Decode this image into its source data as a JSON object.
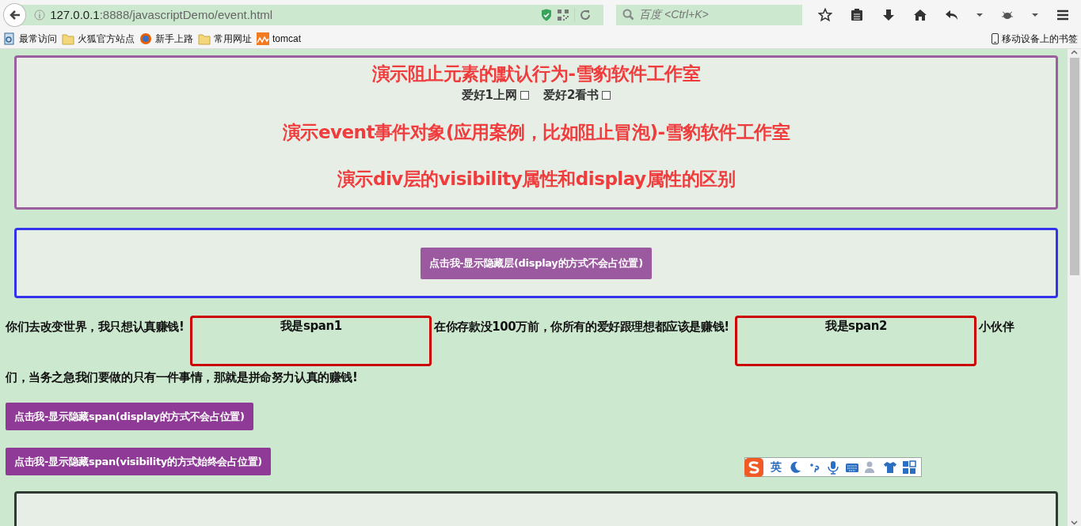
{
  "browser": {
    "url_host": "127.0.0.1",
    "url_rest": ":8888/javascriptDemo/event.html",
    "search": {
      "placeholder": "百度 <Ctrl+K>"
    },
    "bookmarks": [
      {
        "label": "最常访问",
        "kind": "page"
      },
      {
        "label": "火狐官方站点",
        "kind": "folder"
      },
      {
        "label": "新手上路",
        "kind": "globe"
      },
      {
        "label": "常用网址",
        "kind": "folder"
      },
      {
        "label": "tomcat",
        "kind": "tomcat"
      }
    ],
    "mobile_bookmarks": "移动设备上的书签"
  },
  "page": {
    "heading_1": "演示阻止元素的默认行为-雪豹软件工作室",
    "hobbies": [
      {
        "label": "爱好1上网",
        "checked": false
      },
      {
        "label": "爱好2看书",
        "checked": false
      }
    ],
    "heading_2": "演示event事件对象(应用案例，比如阻止冒泡)-雪豹软件工作室",
    "heading_3": "演示div层的visibility属性和display属性的区别",
    "layer_button": "点击我-显示隐藏层(display的方式不会占位置)",
    "paragraph": [
      {
        "kind": "text",
        "text": "你们去改变世界，我只想认真赚钱!"
      },
      {
        "kind": "span",
        "text": "我是span1"
      },
      {
        "kind": "text",
        "text": "在你存款没100万前，你所有的爱好跟理想都应该是赚钱!"
      },
      {
        "kind": "span",
        "text": "我是span2"
      },
      {
        "kind": "text",
        "text": "小伙伴"
      },
      {
        "kind": "text",
        "text": "们，当务之急我们要做的只有一件事情，那就是拼命努力认真的赚钱!"
      }
    ],
    "buttons": [
      "点击我-显示隐藏span(display的方式不会占位置)",
      "点击我-显示隐藏span(visibility的方式始终会占位置)"
    ]
  },
  "ime_toolbar": {
    "mode": "英"
  }
}
